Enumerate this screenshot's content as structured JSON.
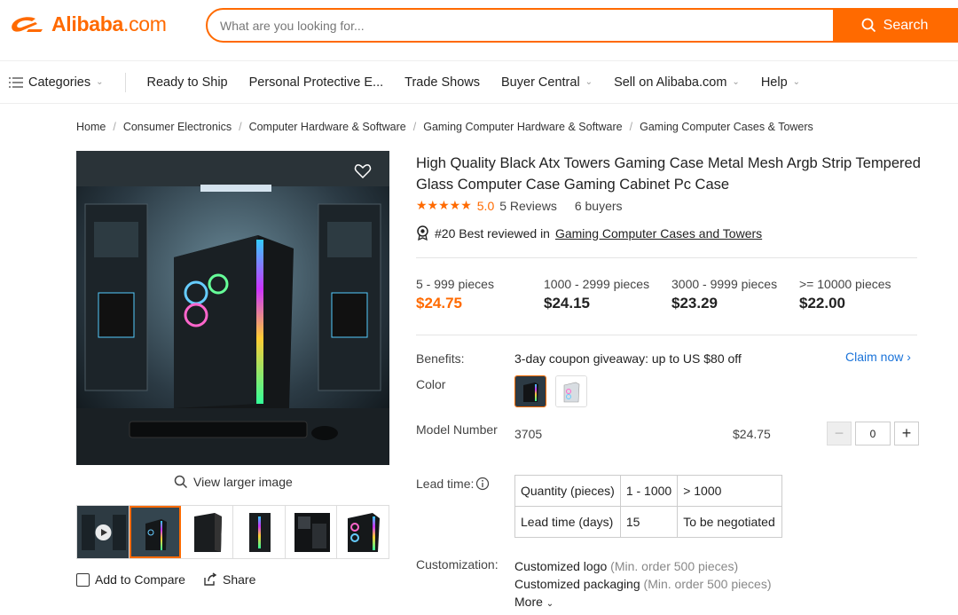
{
  "brand": {
    "name": "Alibaba",
    "suffix": ".com",
    "color": "#ff6a00"
  },
  "search": {
    "placeholder": "What are you looking for...",
    "button_label": "Search"
  },
  "nav": {
    "categories": "Categories",
    "items": [
      "Ready to Ship",
      "Personal Protective E...",
      "Trade Shows",
      "Buyer Central",
      "Sell on Alibaba.com",
      "Help"
    ]
  },
  "breadcrumb": [
    "Home",
    "Consumer Electronics",
    "Computer Hardware & Software",
    "Gaming Computer Hardware & Software",
    "Gaming Computer Cases & Towers"
  ],
  "gallery": {
    "view_larger": "View larger image",
    "add_to_compare": "Add to Compare",
    "share": "Share"
  },
  "product": {
    "title": "High Quality Black Atx Towers Gaming Case Metal Mesh Argb Strip Tempered Glass Computer Case Gaming Cabinet Pc Case",
    "rating": "5.0",
    "reviews": "5 Reviews",
    "buyers": "6 buyers",
    "rank_prefix": "#20 Best reviewed in",
    "rank_link": "Gaming Computer Cases and Towers"
  },
  "price_tiers": [
    {
      "qty": "5 - 999 pieces",
      "price": "$24.75"
    },
    {
      "qty": "1000 - 2999 pieces",
      "price": "$24.15"
    },
    {
      "qty": "3000 - 9999 pieces",
      "price": "$23.29"
    },
    {
      "qty": ">= 10000 pieces",
      "price": "$22.00"
    }
  ],
  "benefits": {
    "label": "Benefits:",
    "text": "3-day coupon giveaway: up to US $80 off",
    "claim": "Claim now"
  },
  "color": {
    "label": "Color"
  },
  "model": {
    "label": "Model Number",
    "value": "3705",
    "price": "$24.75",
    "quantity": "0"
  },
  "lead_time": {
    "label": "Lead time:",
    "rows": [
      [
        "Quantity (pieces)",
        "1 - 1000",
        "> 1000"
      ],
      [
        "Lead time (days)",
        "15",
        "To be negotiated"
      ]
    ]
  },
  "customization": {
    "label": "Customization:",
    "items": [
      {
        "name": "Customized logo",
        "note": "(Min. order 500 pieces)"
      },
      {
        "name": "Customized packaging",
        "note": "(Min. order 500 pieces)"
      }
    ],
    "more": "More"
  }
}
